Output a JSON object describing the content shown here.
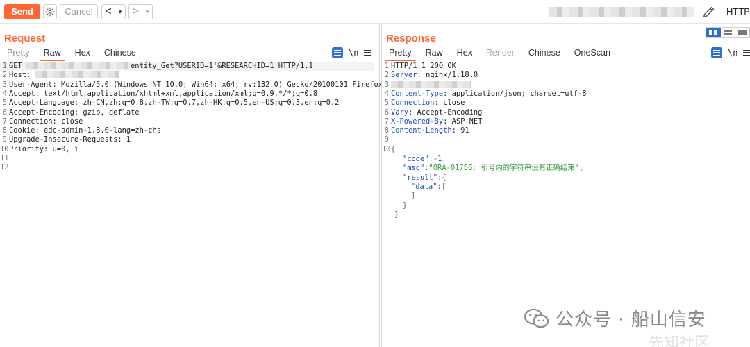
{
  "toolbar": {
    "send_label": "Send",
    "cancel_label": "Cancel",
    "back_arrow": "<",
    "forward_arrow": ">",
    "dropdown_glyph": "▾",
    "target_label": "HTTP/"
  },
  "request": {
    "title": "Request",
    "tabs": [
      "Pretty",
      "Raw",
      "Hex",
      "Chinese"
    ],
    "active_tab": "Raw",
    "newline_toggle": "\\n",
    "lines": [
      {
        "n": "1",
        "pre": "GET ",
        "post": "entity_Get?USERID=1'&RESEARCHID=1 HTTP/1.1"
      },
      {
        "n": "2",
        "pre": "Host: ",
        "post": ""
      },
      {
        "n": "3",
        "pre": "User-Agent: Mozilla/5.0 (Windows NT 10.0; Win64; x64; rv:132.0) Gecko/20100101 Firefox/132.0",
        "post": ""
      },
      {
        "n": "4",
        "pre": "Accept: text/html,application/xhtml+xml,application/xml;q=0.9,*/*;q=0.8",
        "post": ""
      },
      {
        "n": "5",
        "pre": "Accept-Language: zh-CN,zh;q=0.8,zh-TW;q=0.7,zh-HK;q=0.5,en-US;q=0.3,en;q=0.2",
        "post": ""
      },
      {
        "n": "6",
        "pre": "Accept-Encoding: gzip, deflate",
        "post": ""
      },
      {
        "n": "7",
        "pre": "Connection: close",
        "post": ""
      },
      {
        "n": "8",
        "pre": "Cookie: edc-admin-1.8.0-lang=zh-chs",
        "post": ""
      },
      {
        "n": "9",
        "pre": "Upgrade-Insecure-Requests: 1",
        "post": ""
      },
      {
        "n": "10",
        "pre": "Priority: u=0, i",
        "post": ""
      },
      {
        "n": "11",
        "pre": "",
        "post": ""
      },
      {
        "n": "12",
        "pre": "",
        "post": ""
      }
    ]
  },
  "response": {
    "title": "Response",
    "tabs": [
      "Pretty",
      "Raw",
      "Hex",
      "Render",
      "Chinese",
      "OneScan"
    ],
    "active_tab": "Pretty",
    "newline_toggle": "\\n",
    "headers": [
      {
        "n": "1",
        "text": "HTTP/1.1 200 OK"
      },
      {
        "n": "2",
        "key": "Server",
        "value": " nginx/1.18.0"
      },
      {
        "n": "3",
        "text": ""
      },
      {
        "n": "4",
        "key": "Content-Type",
        "value": " application/json; charset=utf-8"
      },
      {
        "n": "5",
        "key": "Connection",
        "value": " close"
      },
      {
        "n": "6",
        "key": "Vary",
        "value": " Accept-Encoding"
      },
      {
        "n": "7",
        "key": "X-Powered-By",
        "value": " ASP.NET"
      },
      {
        "n": "8",
        "key": "Content-Length",
        "value": " 91"
      },
      {
        "n": "9",
        "text": ""
      },
      {
        "n": "10",
        "text": "{"
      }
    ],
    "json": {
      "code_key": "\"code\"",
      "code_val": "-1",
      "msg_key": "\"msg\"",
      "msg_val": "\"ORA-01756: 引号内的字符串没有正确结束\"",
      "result_key": "\"result\"",
      "data_key": "\"data\"",
      "open_brace": "{",
      "open_bracket": "[",
      "close_bracket": "]",
      "close_brace": "}"
    }
  },
  "watermark": {
    "text": "公众号 · 船山信安",
    "faint_text": "先知社区"
  },
  "colors": {
    "accent": "#ff6633",
    "blue": "#2d6fd6"
  }
}
